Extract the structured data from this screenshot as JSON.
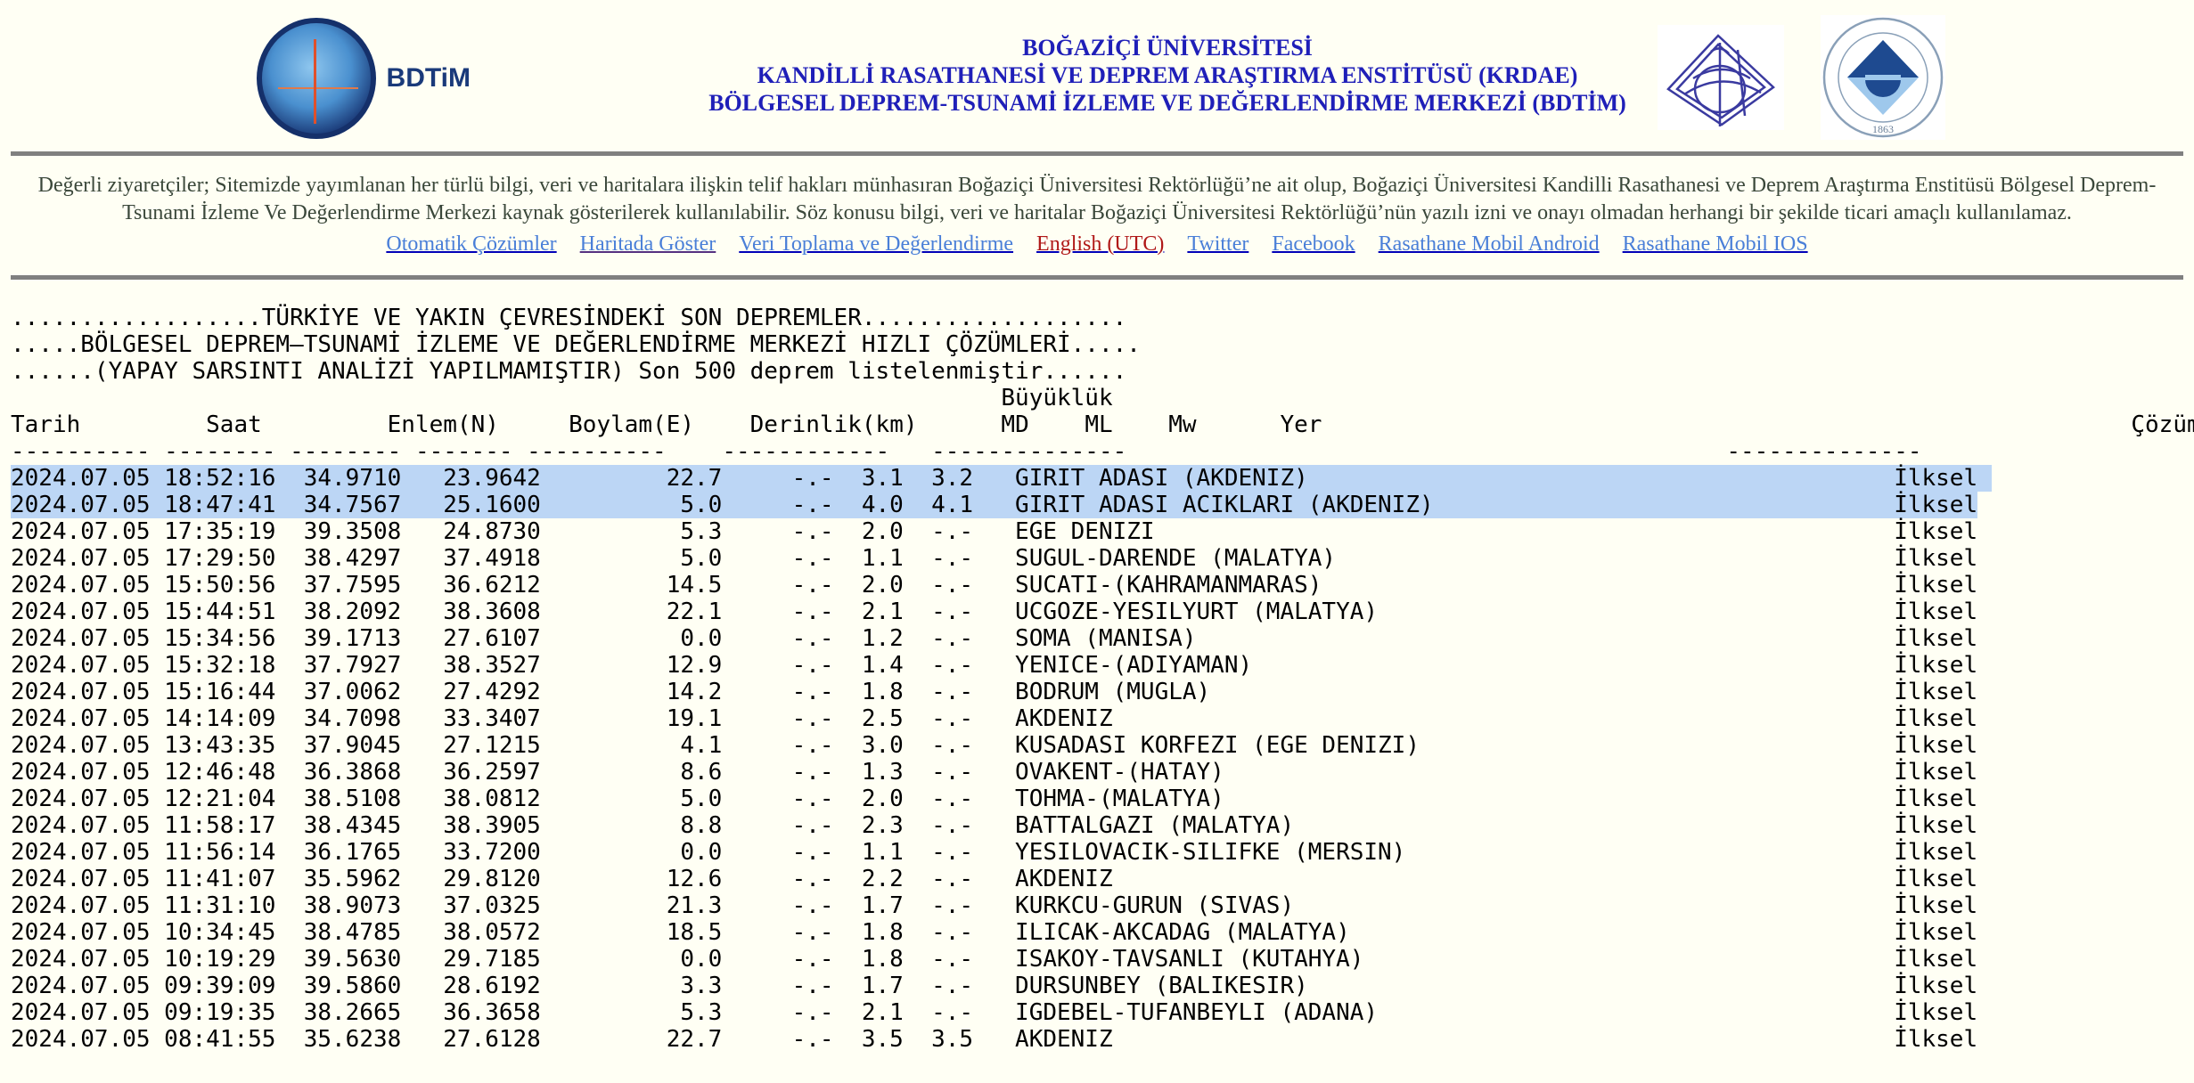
{
  "header": {
    "bdtim_logo_text": "BDTiM",
    "titles": [
      "BOĞAZİÇİ ÜNİVERSİTESİ",
      "KANDİLLİ RASATHANESİ VE DEPREM ARAŞTIRMA ENSTİTÜSÜ (KRDAE)",
      "BÖLGESEL DEPREM-TSUNAMİ İZLEME VE DEĞERLENDİRME MERKEZİ (BDTİM)"
    ],
    "bou_logo_text": "BOĞAZİÇİ ÜNİVERSİTESİ",
    "bou_logo_year": "1863"
  },
  "notice": {
    "text": "Değerli ziyaretçiler; Sitemizde yayımlanan her türlü bilgi, veri ve haritalara ilişkin telif hakları münhasıran Boğaziçi Üniversitesi Rektörlüğü’ne ait olup, Boğaziçi Üniversitesi Kandilli Rasathanesi ve Deprem Araştırma Enstitüsü Bölgesel Deprem-Tsunami İzleme Ve Değerlendirme Merkezi kaynak gösterilerek kullanılabilir. Söz konusu bilgi, veri ve haritalar Boğaziçi Üniversitesi Rektörlüğü’nün yazılı izni ve onayı olmadan herhangi bir şekilde ticari amaçlı kullanılamaz."
  },
  "nav_links": [
    {
      "label": "Otomatik Çözümler",
      "style": "normal"
    },
    {
      "label": "Haritada Göster",
      "style": "visited"
    },
    {
      "label": "Veri Toplama ve Değerlendirme",
      "style": "normal"
    },
    {
      "label": "English (UTC)",
      "style": "red"
    },
    {
      "label": "Twitter",
      "style": "normal"
    },
    {
      "label": "Facebook",
      "style": "normal"
    },
    {
      "label": "Rasathane Mobil Android",
      "style": "normal"
    },
    {
      "label": "Rasathane Mobil IOS",
      "style": "normal"
    }
  ],
  "listing": {
    "heading_lines": [
      "..................TÜRKİYE VE YAKIN ÇEVRESİNDEKİ SON DEPREMLER...................",
      ".....BÖLGESEL DEPREM–TSUNAMİ İZLEME VE DEĞERLENDİRME MERKEZİ HIZLI ÇÖZÜMLERİ.....",
      "......(YAPAY SARSINTI ANALİZİ YAPILMAMIŞTIR) Son 500 deprem listelenmiştir......"
    ],
    "magnitude_group_label": "Büyüklük",
    "columns": [
      "Tarih",
      "Saat",
      "Enlem(N)",
      "Boylam(E)",
      "Derinlik(km)",
      "MD",
      "ML",
      "Mw",
      "Yer",
      "Çözüm Niteliği"
    ],
    "selection_color": "#bcd6f5",
    "selected_rows": [
      0,
      1
    ],
    "rows": [
      [
        "2024.07.05",
        "18:52:16",
        "34.9710",
        "23.9642",
        "22.7",
        "-.-",
        "3.1",
        "3.2",
        "GIRIT ADASI (AKDENIZ)",
        "İlksel"
      ],
      [
        "2024.07.05",
        "18:47:41",
        "34.7567",
        "25.1600",
        "5.0",
        "-.-",
        "4.0",
        "4.1",
        "GIRIT ADASI ACIKLARI (AKDENIZ)",
        "İlksel"
      ],
      [
        "2024.07.05",
        "17:35:19",
        "39.3508",
        "24.8730",
        "5.3",
        "-.-",
        "2.0",
        "-.-",
        "EGE DENIZI",
        "İlksel"
      ],
      [
        "2024.07.05",
        "17:29:50",
        "38.4297",
        "37.4918",
        "5.0",
        "-.-",
        "1.1",
        "-.-",
        "SUGUL-DARENDE (MALATYA)",
        "İlksel"
      ],
      [
        "2024.07.05",
        "15:50:56",
        "37.7595",
        "36.6212",
        "14.5",
        "-.-",
        "2.0",
        "-.-",
        "SUCATI-(KAHRAMANMARAS)",
        "İlksel"
      ],
      [
        "2024.07.05",
        "15:44:51",
        "38.2092",
        "38.3608",
        "22.1",
        "-.-",
        "2.1",
        "-.-",
        "UCGOZE-YESILYURT (MALATYA)",
        "İlksel"
      ],
      [
        "2024.07.05",
        "15:34:56",
        "39.1713",
        "27.6107",
        "0.0",
        "-.-",
        "1.2",
        "-.-",
        "SOMA (MANISA)",
        "İlksel"
      ],
      [
        "2024.07.05",
        "15:32:18",
        "37.7927",
        "38.3527",
        "12.9",
        "-.-",
        "1.4",
        "-.-",
        "YENICE-(ADIYAMAN)",
        "İlksel"
      ],
      [
        "2024.07.05",
        "15:16:44",
        "37.0062",
        "27.4292",
        "14.2",
        "-.-",
        "1.8",
        "-.-",
        "BODRUM (MUGLA)",
        "İlksel"
      ],
      [
        "2024.07.05",
        "14:14:09",
        "34.7098",
        "33.3407",
        "19.1",
        "-.-",
        "2.5",
        "-.-",
        "AKDENIZ",
        "İlksel"
      ],
      [
        "2024.07.05",
        "13:43:35",
        "37.9045",
        "27.1215",
        "4.1",
        "-.-",
        "3.0",
        "-.-",
        "KUSADASI KORFEZI (EGE DENIZI)",
        "İlksel"
      ],
      [
        "2024.07.05",
        "12:46:48",
        "36.3868",
        "36.2597",
        "8.6",
        "-.-",
        "1.3",
        "-.-",
        "OVAKENT-(HATAY)",
        "İlksel"
      ],
      [
        "2024.07.05",
        "12:21:04",
        "38.5108",
        "38.0812",
        "5.0",
        "-.-",
        "2.0",
        "-.-",
        "TOHMA-(MALATYA)",
        "İlksel"
      ],
      [
        "2024.07.05",
        "11:58:17",
        "38.4345",
        "38.3905",
        "8.8",
        "-.-",
        "2.3",
        "-.-",
        "BATTALGAZI (MALATYA)",
        "İlksel"
      ],
      [
        "2024.07.05",
        "11:56:14",
        "36.1765",
        "33.7200",
        "0.0",
        "-.-",
        "1.1",
        "-.-",
        "YESILOVACIK-SILIFKE (MERSIN)",
        "İlksel"
      ],
      [
        "2024.07.05",
        "11:41:07",
        "35.5962",
        "29.8120",
        "12.6",
        "-.-",
        "2.2",
        "-.-",
        "AKDENIZ",
        "İlksel"
      ],
      [
        "2024.07.05",
        "11:31:10",
        "38.9073",
        "37.0325",
        "21.3",
        "-.-",
        "1.7",
        "-.-",
        "KURKCU-GURUN (SIVAS)",
        "İlksel"
      ],
      [
        "2024.07.05",
        "10:34:45",
        "38.4785",
        "38.0572",
        "18.5",
        "-.-",
        "1.8",
        "-.-",
        "ILICAK-AKCADAG (MALATYA)",
        "İlksel"
      ],
      [
        "2024.07.05",
        "10:19:29",
        "39.5630",
        "29.7185",
        "0.0",
        "-.-",
        "1.8",
        "-.-",
        "ISAKOY-TAVSANLI (KUTAHYA)",
        "İlksel"
      ],
      [
        "2024.07.05",
        "09:39:09",
        "39.5860",
        "28.6192",
        "3.3",
        "-.-",
        "1.7",
        "-.-",
        "DURSUNBEY (BALIKESIR)",
        "İlksel"
      ],
      [
        "2024.07.05",
        "09:19:35",
        "38.2665",
        "36.3658",
        "5.3",
        "-.-",
        "2.1",
        "-.-",
        "IGDEBEL-TUFANBEYLI (ADANA)",
        "İlksel"
      ],
      [
        "2024.07.05",
        "08:41:55",
        "35.6238",
        "27.6128",
        "22.7",
        "-.-",
        "3.5",
        "3.5",
        "AKDENIZ",
        "İlksel"
      ]
    ]
  }
}
